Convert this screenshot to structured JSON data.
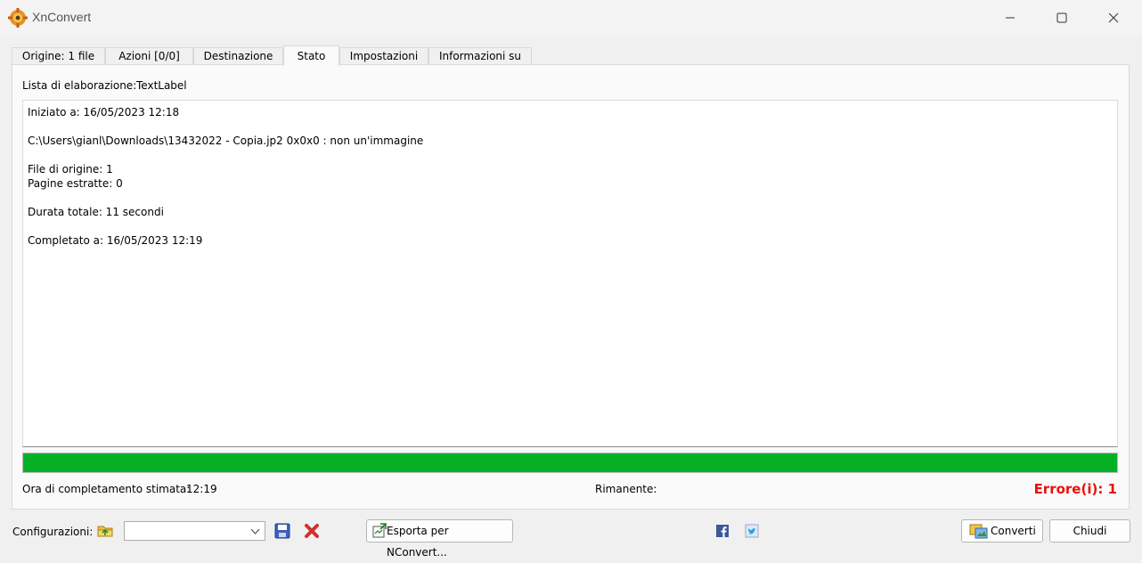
{
  "window": {
    "title": "XnConvert"
  },
  "tabs": [
    {
      "label": "Origine: 1 file"
    },
    {
      "label": "Azioni [0/0]"
    },
    {
      "label": "Destinazione"
    },
    {
      "label": "Stato",
      "active": true
    },
    {
      "label": "Impostazioni"
    },
    {
      "label": "Informazioni su"
    }
  ],
  "processing": {
    "label": "Lista di elaborazione:",
    "value": "TextLabel"
  },
  "log": {
    "lines": [
      "Iniziato a: 16/05/2023 12:18",
      "C:\\Users\\gianl\\Downloads\\13432022 - Copia.jp2 0x0x0 : non un'immagine",
      "File di origine: 1",
      "Pagine estratte: 0",
      "Durata totale: 11 secondi",
      "Completato a: 16/05/2023 12:19"
    ]
  },
  "progress": {
    "fraction": 1.0,
    "color": "#06b025"
  },
  "status": {
    "eta_label": "Ora di completamento stimata:",
    "eta_value": "12:19",
    "remaining_label": "Rimanente:",
    "errors": "Errore(i): 1",
    "error_color": "#e8100d"
  },
  "footer": {
    "configurations_label": "Configurazioni:",
    "config_selected": "",
    "export_label": "Esporta per NConvert...",
    "convert_label": "Converti",
    "close_label": "Chiudi"
  }
}
